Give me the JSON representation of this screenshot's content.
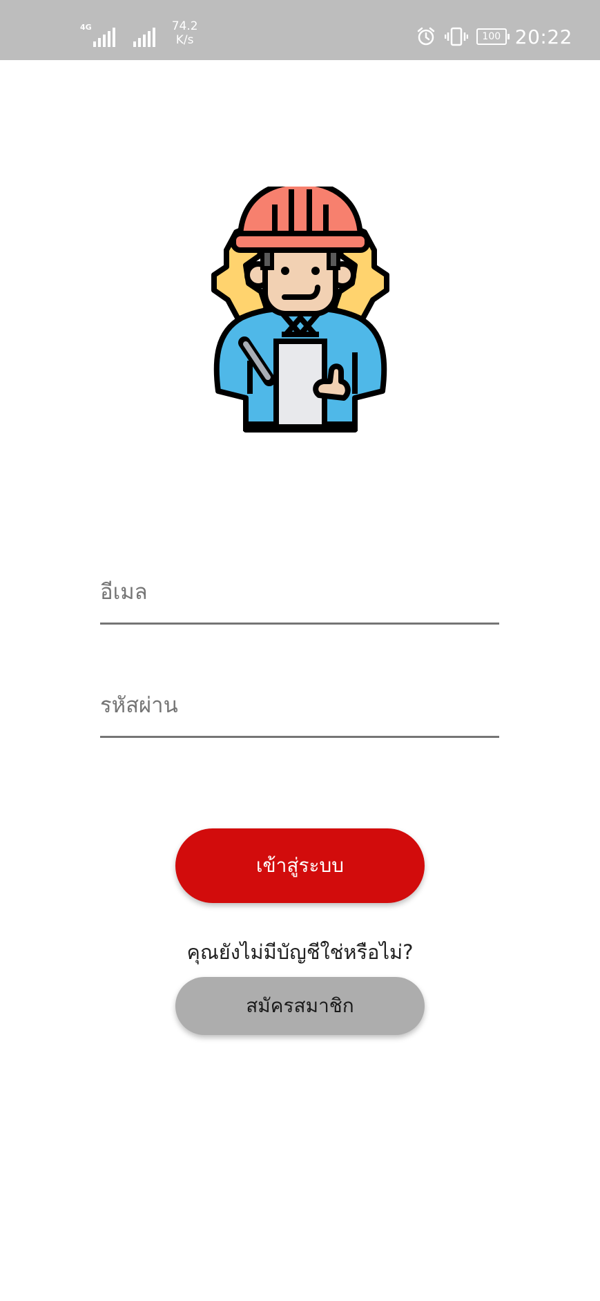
{
  "status_bar": {
    "network_type": "4G",
    "net_speed_value": "74.2",
    "net_speed_unit": "K/s",
    "battery": "100",
    "time": "20:22",
    "icons": [
      "signal-icon",
      "signal-icon",
      "alarm-icon",
      "vibrate-icon",
      "battery-icon"
    ]
  },
  "logo": {
    "icon": "engineer-icon",
    "colors": {
      "helmet": "#f7806e",
      "gear": "#ffd36e",
      "shirt": "#4fb8e8",
      "skin": "#f2d1b3",
      "clipboard": "#e8e9ec",
      "outline": "#000000"
    }
  },
  "form": {
    "email_placeholder": "อีเมล",
    "email_value": "",
    "password_placeholder": "รหัสผ่าน",
    "password_value": ""
  },
  "actions": {
    "login_label": "เข้าสู่ระบบ",
    "no_account_text": "คุณยังไม่มีบัญชีใช่หรือไม่?",
    "register_label": "สมัครสมาชิก"
  },
  "colors": {
    "login_button": "#d20c0c",
    "register_button": "#adadad",
    "status_bar": "#bdbdbd",
    "field_underline": "#757575"
  }
}
